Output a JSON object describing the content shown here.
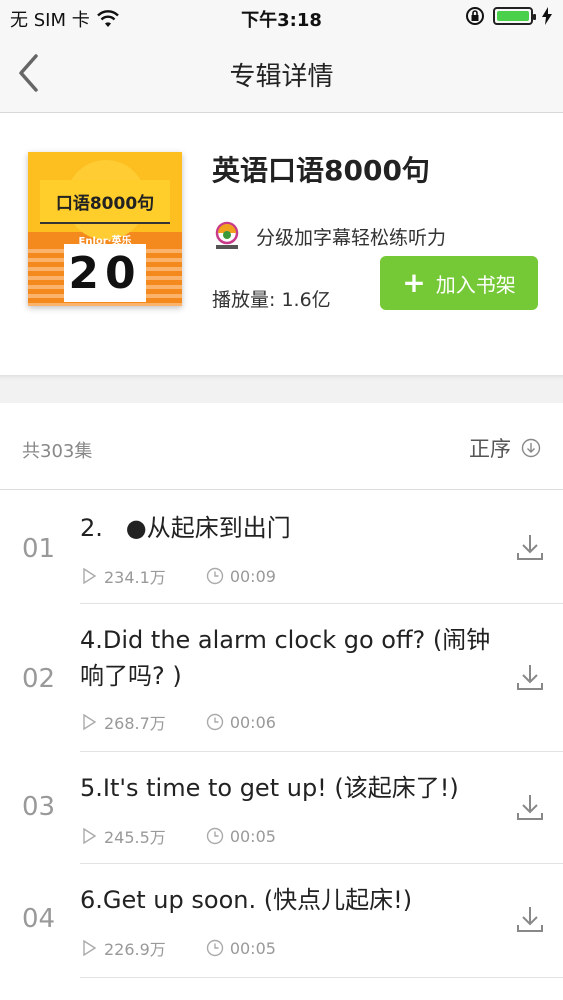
{
  "status_bar": {
    "carrier": "无 SIM 卡",
    "time": "下午3:18"
  },
  "nav": {
    "title": "专辑详情"
  },
  "album": {
    "cover_title": "口语8000句",
    "cover_brand": "Enlor·英乐",
    "cover_number": "20",
    "name": "英语口语8000句",
    "description": "分级加字幕轻松练听力",
    "plays_label": "播放量: 1.6亿",
    "add_button_label": "加入书架"
  },
  "list": {
    "count_label": "共303集",
    "sort_label": "正序",
    "tracks": [
      {
        "num": "01",
        "title": "2.   ●从起床到出门",
        "plays": "234.1万",
        "duration": "00:09"
      },
      {
        "num": "02",
        "title": "4.Did the alarm clock go off? (闹钟响了吗? )",
        "plays": "268.7万",
        "duration": "00:06"
      },
      {
        "num": "03",
        "title": "5.It's time to get up! (该起床了!)",
        "plays": "245.5万",
        "duration": "00:05"
      },
      {
        "num": "04",
        "title": "6.Get up soon. (快点儿起床!)",
        "plays": "226.9万",
        "duration": "00:05"
      }
    ]
  },
  "colors": {
    "accent_green": "#76c936",
    "cover_orange": "#f48a1e",
    "cover_yellow": "#ffce2b"
  },
  "icons": {
    "back": "chevron-left-icon",
    "play": "play-icon",
    "clock": "clock-icon",
    "download": "download-icon",
    "sort": "sort-down-icon"
  }
}
